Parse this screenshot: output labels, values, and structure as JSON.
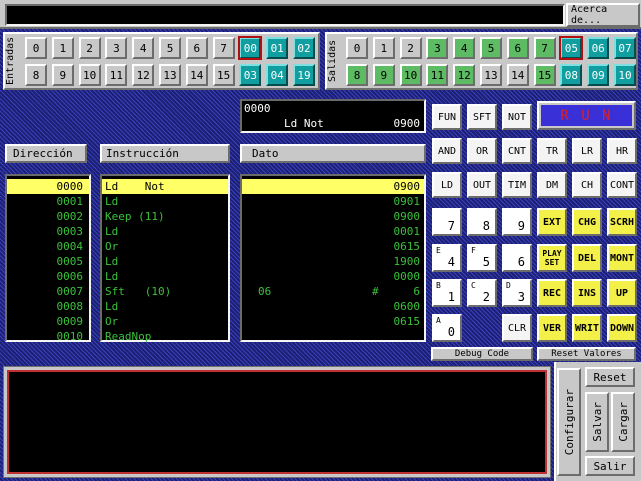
{
  "top": {
    "acerca_label": "Acerca de..."
  },
  "entradas": {
    "label": "Entradas",
    "row1": [
      {
        "t": "0",
        "s": "n"
      },
      {
        "t": "1",
        "s": "n"
      },
      {
        "t": "2",
        "s": "n"
      },
      {
        "t": "3",
        "s": "n"
      },
      {
        "t": "4",
        "s": "n"
      },
      {
        "t": "5",
        "s": "n"
      },
      {
        "t": "6",
        "s": "n"
      },
      {
        "t": "7",
        "s": "n"
      },
      {
        "t": "00",
        "s": "sel"
      },
      {
        "t": "01",
        "s": "c"
      },
      {
        "t": "02",
        "s": "c"
      }
    ],
    "row2": [
      {
        "t": "8",
        "s": "n"
      },
      {
        "t": "9",
        "s": "n"
      },
      {
        "t": "10",
        "s": "n"
      },
      {
        "t": "11",
        "s": "n"
      },
      {
        "t": "12",
        "s": "n"
      },
      {
        "t": "13",
        "s": "n"
      },
      {
        "t": "14",
        "s": "n"
      },
      {
        "t": "15",
        "s": "n"
      },
      {
        "t": "03",
        "s": "c"
      },
      {
        "t": "04",
        "s": "c"
      },
      {
        "t": "19",
        "s": "c"
      }
    ]
  },
  "salidas": {
    "label": "Salidas",
    "row1": [
      {
        "t": "0",
        "s": "n"
      },
      {
        "t": "1",
        "s": "n"
      },
      {
        "t": "2",
        "s": "n"
      },
      {
        "t": "3",
        "s": "g"
      },
      {
        "t": "4",
        "s": "g"
      },
      {
        "t": "5",
        "s": "g"
      },
      {
        "t": "6",
        "s": "g"
      },
      {
        "t": "7",
        "s": "g"
      },
      {
        "t": "05",
        "s": "sel"
      },
      {
        "t": "06",
        "s": "c"
      },
      {
        "t": "07",
        "s": "c"
      }
    ],
    "row2": [
      {
        "t": "8",
        "s": "g"
      },
      {
        "t": "9",
        "s": "g"
      },
      {
        "t": "10",
        "s": "g"
      },
      {
        "t": "11",
        "s": "g"
      },
      {
        "t": "12",
        "s": "g"
      },
      {
        "t": "13",
        "s": "n"
      },
      {
        "t": "14",
        "s": "n"
      },
      {
        "t": "15",
        "s": "g"
      },
      {
        "t": "08",
        "s": "c"
      },
      {
        "t": "09",
        "s": "c"
      },
      {
        "t": "10",
        "s": "c"
      }
    ]
  },
  "display": {
    "line1": "0000",
    "line2_instr": "Ld Not",
    "line2_val": "0900"
  },
  "run_label": "R U N",
  "headers": {
    "direccion": "Dirección",
    "instruccion": "Instrucción",
    "dato": "Dato"
  },
  "rows": [
    {
      "addr": "0000",
      "instr": "Ld    Not",
      "dato_left": "",
      "dato_mid": "",
      "dato": "0900"
    },
    {
      "addr": "0001",
      "instr": "Ld",
      "dato_left": "",
      "dato_mid": "",
      "dato": "0901"
    },
    {
      "addr": "0002",
      "instr": "Keep (11)",
      "dato_left": "",
      "dato_mid": "",
      "dato": "0900"
    },
    {
      "addr": "0003",
      "instr": "Ld",
      "dato_left": "",
      "dato_mid": "",
      "dato": "0001"
    },
    {
      "addr": "0004",
      "instr": "Or",
      "dato_left": "",
      "dato_mid": "",
      "dato": "0615"
    },
    {
      "addr": "0005",
      "instr": "Ld",
      "dato_left": "",
      "dato_mid": "",
      "dato": "1900"
    },
    {
      "addr": "0006",
      "instr": "Ld",
      "dato_left": "",
      "dato_mid": "",
      "dato": "0000"
    },
    {
      "addr": "0007",
      "instr": "Sft   (10)",
      "dato_left": "06",
      "dato_mid": "#",
      "dato": "6"
    },
    {
      "addr": "0008",
      "instr": "Ld",
      "dato_left": "",
      "dato_mid": "",
      "dato": "0600"
    },
    {
      "addr": "0009",
      "instr": "Or",
      "dato_left": "",
      "dato_mid": "",
      "dato": "0615"
    },
    {
      "addr": "0010",
      "instr": "ReadNop",
      "dato_left": "",
      "dato_mid": "",
      "dato": ""
    }
  ],
  "fn_buttons": {
    "row1": [
      "FUN",
      "SFT",
      "NOT"
    ],
    "row2": [
      "AND",
      "OR",
      "CNT",
      "TR",
      "LR",
      "HR"
    ],
    "row3": [
      "LD",
      "OUT",
      "TIM",
      "DM",
      "CH",
      "CONT"
    ]
  },
  "keypad": {
    "row1": [
      {
        "sup": "",
        "val": "7"
      },
      {
        "sup": "",
        "val": "8"
      },
      {
        "sup": "",
        "val": "9"
      }
    ],
    "row2": [
      {
        "sup": "E",
        "val": "4"
      },
      {
        "sup": "F",
        "val": "5"
      },
      {
        "sup": "",
        "val": "6"
      }
    ],
    "row3": [
      {
        "sup": "B",
        "val": "1"
      },
      {
        "sup": "C",
        "val": "2"
      },
      {
        "sup": "D",
        "val": "3"
      }
    ],
    "row4": [
      {
        "sup": "A",
        "val": "0"
      }
    ]
  },
  "ctl_buttons": {
    "row1": [
      "EXT",
      "CHG",
      "SCRH"
    ],
    "row2": [
      "PLAY SET",
      "DEL",
      "MONT"
    ],
    "row3": [
      "REC",
      "INS",
      "UP"
    ],
    "row4": [
      "CLR",
      "VER",
      "WRIT",
      "DOWN"
    ]
  },
  "debug_label": "Debug Code",
  "reset_valores_label": "Reset Valores",
  "bottom": {
    "configurar": "Configurar",
    "reset": "Reset",
    "salvar": "Salvar",
    "cargar": "Cargar",
    "salir": "Salir"
  },
  "colors": {
    "accent_green": "#3ac13a",
    "highlight": "#ffff66",
    "run_text": "#e02020",
    "run_bg": "#3a30d8"
  }
}
